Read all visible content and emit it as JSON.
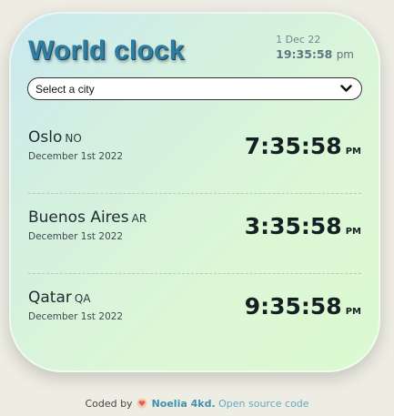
{
  "app": {
    "title": "World clock"
  },
  "now": {
    "date": "1 Dec 22",
    "time": "19:35:58",
    "ampm": "pm"
  },
  "select": {
    "placeholder": "Select a city"
  },
  "cities": [
    {
      "name": "Oslo",
      "code": "NO",
      "date": "December 1st 2022",
      "time": "7:35:58",
      "ampm": "PM"
    },
    {
      "name": "Buenos Aires",
      "code": "AR",
      "date": "December 1st 2022",
      "time": "3:35:58",
      "ampm": "PM"
    },
    {
      "name": "Qatar",
      "code": "QA",
      "date": "December 1st 2022",
      "time": "9:35:58",
      "ampm": "PM"
    }
  ],
  "footer": {
    "prefix": "Coded by",
    "author": "Noelia 4kd.",
    "source_link": "Open source code"
  },
  "colors": {
    "accent": "#2f7da0",
    "link": "#64a7c2",
    "card_gradient_start": "#c9e8f0",
    "card_gradient_end": "#dbfad0"
  },
  "icons": {
    "dropdown": "chevron-down-icon",
    "footer": "heart-icon"
  }
}
